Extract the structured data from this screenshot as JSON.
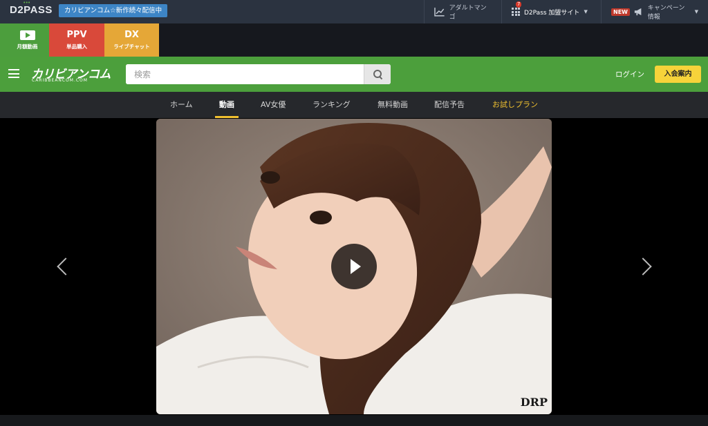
{
  "topbar": {
    "logo": "D2PASS",
    "promo": "カリビアンコム☆新作続々配信中",
    "links": [
      {
        "label": "アダルトマンゴ",
        "icon": "trend-chart-icon"
      },
      {
        "label": "D2Pass 加盟サイト",
        "badge": "7",
        "icon": "grid-icon"
      },
      {
        "label": "キャンペーン情報",
        "badge": "NEW",
        "icon": "megaphone-icon"
      }
    ]
  },
  "services": [
    {
      "title": "",
      "label": "月額動画",
      "color": "#4c9e3d",
      "icon": "play-icon"
    },
    {
      "title": "PPV",
      "label": "単品購入",
      "color": "#d9493a"
    },
    {
      "title": "DX",
      "label": "ライブチャット",
      "color": "#e5a737"
    }
  ],
  "header": {
    "logo": "カリビアンコム",
    "logo_sub": "CARIBBEANCOM.COM",
    "search_placeholder": "検索",
    "login": "ログイン",
    "join": "入会案内",
    "accent": "#4c9f3c"
  },
  "nav": {
    "items": [
      "ホーム",
      "動画",
      "AV女優",
      "ランキング",
      "無料動画",
      "配信予告",
      "お試しプラン"
    ],
    "active": "動画",
    "highlight_color": "#f2c230"
  },
  "hero": {
    "watermark": "DRP"
  }
}
